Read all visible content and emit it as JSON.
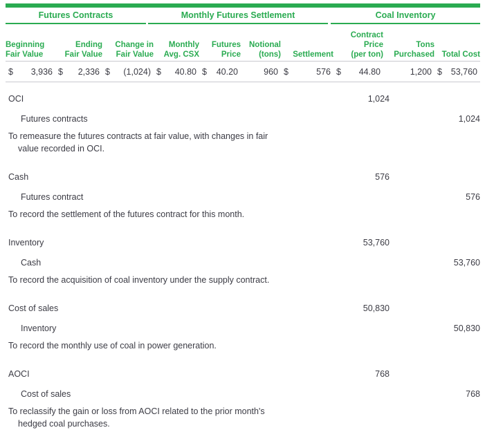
{
  "table": {
    "groups": [
      {
        "label": "Futures Contracts"
      },
      {
        "label": "Monthly Futures Settlement"
      },
      {
        "label": "Coal Inventory"
      }
    ],
    "columns": [
      {
        "line1": "Beginning",
        "line2": "Fair Value",
        "line3": ""
      },
      {
        "line1": "Ending",
        "line2": "Fair Value",
        "line3": ""
      },
      {
        "line1": "Change in",
        "line2": "Fair Value",
        "line3": ""
      },
      {
        "line1": "Monthly",
        "line2": "Avg. CSX",
        "line3": ""
      },
      {
        "line1": "Futures",
        "line2": "Price",
        "line3": ""
      },
      {
        "line1": "Notional",
        "line2": "(tons)",
        "line3": ""
      },
      {
        "line1": "",
        "line2": "Settlement",
        "line3": ""
      },
      {
        "line1": "Contract",
        "line2": "Price",
        "line3": "(per ton)"
      },
      {
        "line1": "Tons",
        "line2": "Purchased",
        "line3": ""
      },
      {
        "line1": "",
        "line2": "Total Cost",
        "line3": ""
      }
    ],
    "row": [
      {
        "currency": "$",
        "value": "3,936"
      },
      {
        "currency": "$",
        "value": "2,336"
      },
      {
        "currency": "$",
        "value": "(1,024)"
      },
      {
        "currency": "$",
        "value": "40.80"
      },
      {
        "currency": "$",
        "value": "40.20"
      },
      {
        "currency": "",
        "value": "960"
      },
      {
        "currency": "$",
        "value": "576"
      },
      {
        "currency": "$",
        "value": "44.80"
      },
      {
        "currency": "",
        "value": "1,200"
      },
      {
        "currency": "$",
        "value": "53,760"
      }
    ]
  },
  "journal_entries": [
    {
      "debit_account": "OCI",
      "debit_amount": "1,024",
      "credit_account": "Futures contracts",
      "credit_amount": "1,024",
      "description_line1": "To remeasure the futures contracts at fair value, with changes in fair",
      "description_line2": "value recorded in OCI."
    },
    {
      "debit_account": "Cash",
      "debit_amount": "576",
      "credit_account": "Futures contract",
      "credit_amount": "576",
      "description_line1": "To record the settlement of the futures contract for this month.",
      "description_line2": ""
    },
    {
      "debit_account": "Inventory",
      "debit_amount": "53,760",
      "credit_account": "Cash",
      "credit_amount": "53,760",
      "description_line1": "To record the acquisition of coal inventory under the supply contract.",
      "description_line2": ""
    },
    {
      "debit_account": "Cost of sales",
      "debit_amount": "50,830",
      "credit_account": "Inventory",
      "credit_amount": "50,830",
      "description_line1": "To record the monthly use of coal in power generation.",
      "description_line2": ""
    },
    {
      "debit_account": "AOCI",
      "debit_amount": "768",
      "credit_account": "Cost of sales",
      "credit_amount": "768",
      "description_line1": "To reclassify the gain or loss from AOCI related to the prior month's",
      "description_line2": "hedged coal purchases."
    }
  ],
  "colors": {
    "accent_green": "#2aab51",
    "body_text": "#3b3b44",
    "rule_gray": "#c9c9cf"
  }
}
